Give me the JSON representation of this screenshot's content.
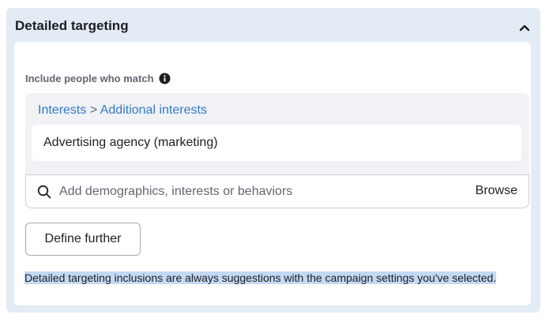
{
  "panel": {
    "title": "Detailed targeting"
  },
  "include": {
    "label": "Include people who match"
  },
  "breadcrumb": {
    "first": "Interests",
    "separator": ">",
    "second": "Additional interests"
  },
  "selected_interest": "Advertising agency (marketing)",
  "search": {
    "placeholder": "Add demographics, interests or behaviors",
    "value": "",
    "browse_label": "Browse"
  },
  "define_further_label": "Define further",
  "note": "Detailed targeting inclusions are always suggestions with the campaign settings you've selected.",
  "icons": {
    "collapse": "chevron-up-icon",
    "info": "info-icon",
    "search": "search-icon"
  },
  "colors": {
    "panel_bg": "#e3ebf5",
    "link": "#3578c8",
    "selection_highlight": "#c3d9f3"
  }
}
